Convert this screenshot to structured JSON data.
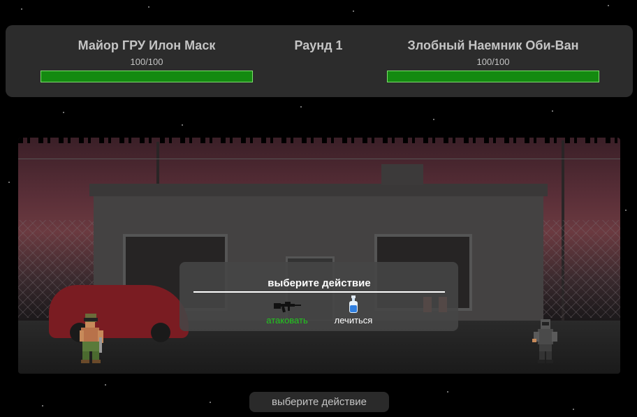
{
  "hud": {
    "player": {
      "name": "Майор ГРУ Илон Маск",
      "hp_text": "100/100",
      "hp_fraction": 1.0
    },
    "round": "Раунд 1",
    "enemy": {
      "name": "Злобный Наемник Оби-Ван",
      "hp_text": "100/100",
      "hp_fraction": 1.0
    }
  },
  "popup": {
    "title": "выберите действие",
    "actions": [
      {
        "label": "атаковать",
        "icon": "rifle-icon"
      },
      {
        "label": "лечиться",
        "icon": "potion-bottle-icon"
      }
    ]
  },
  "status": {
    "text": "выберите действие"
  },
  "colors": {
    "hp_bar": "#148a10",
    "attack_label": "#22c81e",
    "panel": "#2c2c2c"
  }
}
